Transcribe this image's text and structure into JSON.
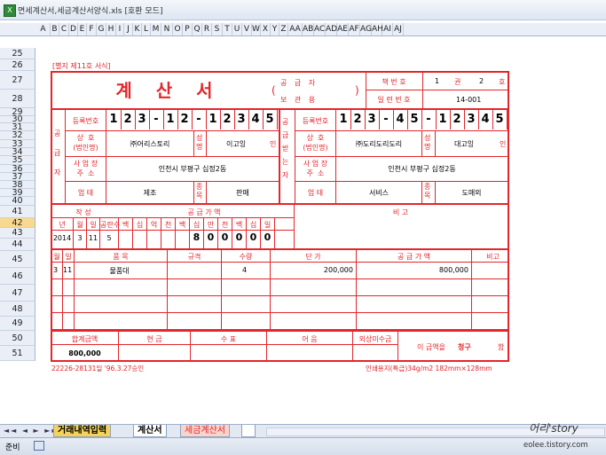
{
  "window": {
    "title": "면세계산서,세금계산서양식.xls [호환 모드]"
  },
  "columns": [
    "A",
    "B",
    "C",
    "D",
    "E",
    "F",
    "G",
    "H",
    "I",
    "J",
    "K",
    "L",
    "M",
    "N",
    "O",
    "P",
    "Q",
    "R",
    "S",
    "T",
    "U",
    "V",
    "W",
    "X",
    "Y",
    "Z",
    "AA",
    "AB",
    "AC",
    "AD",
    "AE",
    "AF",
    "AG",
    "AH",
    "AI",
    "AJ"
  ],
  "rows": [
    "25",
    "26",
    "27",
    "28",
    "29",
    "30",
    "31",
    "32",
    "33",
    "34",
    "35",
    "36",
    "37",
    "38",
    "39",
    "40",
    "41",
    "42",
    "43",
    "44",
    "45",
    "46",
    "47",
    "48",
    "49",
    "50",
    "51"
  ],
  "selected_row": "42",
  "form": {
    "header_note": "[별지 제11호 서식]",
    "title": "계 산 서",
    "supplier_side": "공  급  자",
    "recipient_side": "보  관  용",
    "book_no_label": "책 번 호",
    "book_no": "1",
    "book_unit1": "권",
    "book_no2": "2",
    "book_unit2": "호",
    "serial_label": "일 련 번 호",
    "serial": "14-001",
    "supplier_vertical": "공 급 자",
    "recipient_vertical": "공급받는자",
    "reg_label": "등록번호",
    "supplier_reg_digits": [
      "1",
      "2",
      "3",
      "-",
      "1",
      "2",
      "-",
      "1",
      "2",
      "3",
      "4",
      "5"
    ],
    "recipient_reg_digits": [
      "1",
      "2",
      "3",
      "-",
      "4",
      "5",
      "-",
      "1",
      "2",
      "3",
      "4",
      "5"
    ],
    "name_label": "상  호\n(법인명)",
    "supplier_name": "㈜어리스토리",
    "recipient_name": "㈜도리도리도리",
    "rep_label": "성명",
    "supplier_rep": "이고잉",
    "recipient_rep": "대고잉",
    "seal": "인",
    "addr_label": "사 업 장\n주  소",
    "supplier_addr": "인천시 부평구 십정2동",
    "recipient_addr": "인천시 부평구 십정2동",
    "biz_label": "업  태",
    "supplier_biz": "제조",
    "recipient_biz": "서비스",
    "item_label": "종목",
    "supplier_item": "판매",
    "recipient_item": "도매외",
    "date_section": "작  성",
    "supply_section": "공   급   가   액",
    "remarks_section": "비   고",
    "date_headers": [
      "년",
      "월",
      "일"
    ],
    "blank_label": "공란수",
    "amount_headers": [
      "백",
      "십",
      "억",
      "천",
      "백",
      "십",
      "만",
      "천",
      "백",
      "십",
      "일"
    ],
    "year": "2014",
    "month": "3",
    "day": "11",
    "blank_count": "5",
    "amount_digits": [
      "",
      "",
      "",
      "",
      "",
      "8",
      "0",
      "0",
      "0",
      "0",
      "0"
    ],
    "items_headers": {
      "month": "월",
      "day": "일",
      "item": "품   목",
      "spec": "규격",
      "qty": "수량",
      "price": "단   가",
      "supply": "공 급 가 액",
      "note": "비고"
    },
    "items": [
      {
        "month": "3",
        "day": "11",
        "item": "물품대",
        "spec": "",
        "qty": "4",
        "price": "200,000",
        "supply": "800,000",
        "note": ""
      }
    ],
    "totals_headers": {
      "total": "합계금액",
      "cash": "현  금",
      "check": "수  표",
      "bill": "어  음",
      "credit": "외상미수금"
    },
    "total_amount": "800,000",
    "receipt_text": "이 금액을",
    "receipt_bold": "청구",
    "receipt_end": "함",
    "footer_left": "22226-28131일 '96.3.27승인",
    "footer_right": "인쇄용지(특급)34g/m2 182mm×128mm"
  },
  "tabs": [
    "거래내역입력",
    "계산서",
    "세금계산서"
  ],
  "status": {
    "ready": "준비"
  },
  "watermark": {
    "name": "어리'story",
    "url": "eolee.tistory.com"
  }
}
